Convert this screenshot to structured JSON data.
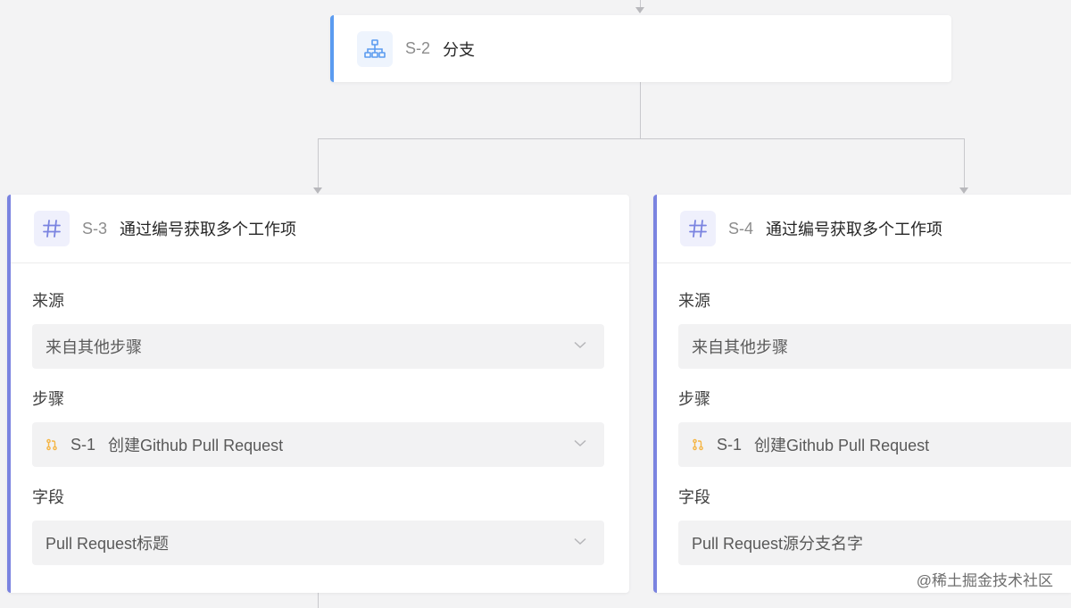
{
  "colors": {
    "background": "#f3f3f4",
    "branch_accent": "#5b9bf0",
    "workitem_accent": "#7a83e0",
    "branch_icon": "#5b9bf0",
    "hash_icon": "#7a83e0",
    "pr_icon": "#f5b544"
  },
  "branch_node": {
    "code": "S-2",
    "title": "分支",
    "icon": "branch-icon"
  },
  "cards": [
    {
      "code": "S-3",
      "title": "通过编号获取多个工作项",
      "icon": "hash-icon",
      "fields": {
        "source_label": "来源",
        "source_value": "来自其他步骤",
        "step_label": "步骤",
        "step_code": "S-1",
        "step_value": "创建Github Pull Request",
        "field_label": "字段",
        "field_value": "Pull Request标题"
      }
    },
    {
      "code": "S-4",
      "title": "通过编号获取多个工作项",
      "icon": "hash-icon",
      "fields": {
        "source_label": "来源",
        "source_value": "来自其他步骤",
        "step_label": "步骤",
        "step_code": "S-1",
        "step_value": "创建Github Pull Request",
        "field_label": "字段",
        "field_value": "Pull Request源分支名字"
      }
    }
  ],
  "watermark": "@稀土掘金技术社区"
}
